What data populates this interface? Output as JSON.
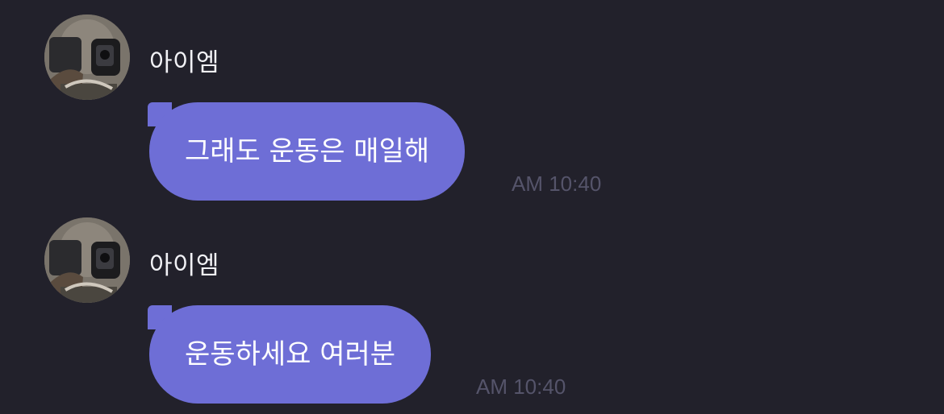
{
  "messages": [
    {
      "sender": "아이엠",
      "avatar_icon": "profile-photo-avatar",
      "text": "그래도 운동은 매일해",
      "time": "AM 10:40"
    },
    {
      "sender": "아이엠",
      "avatar_icon": "profile-photo-avatar",
      "text": "운동하세요 여러분",
      "time": "AM 10:40"
    }
  ],
  "colors": {
    "background": "#22212b",
    "bubble": "#6e6ed6",
    "sender_text": "#f1f1f5",
    "timestamp": "#55546a"
  }
}
